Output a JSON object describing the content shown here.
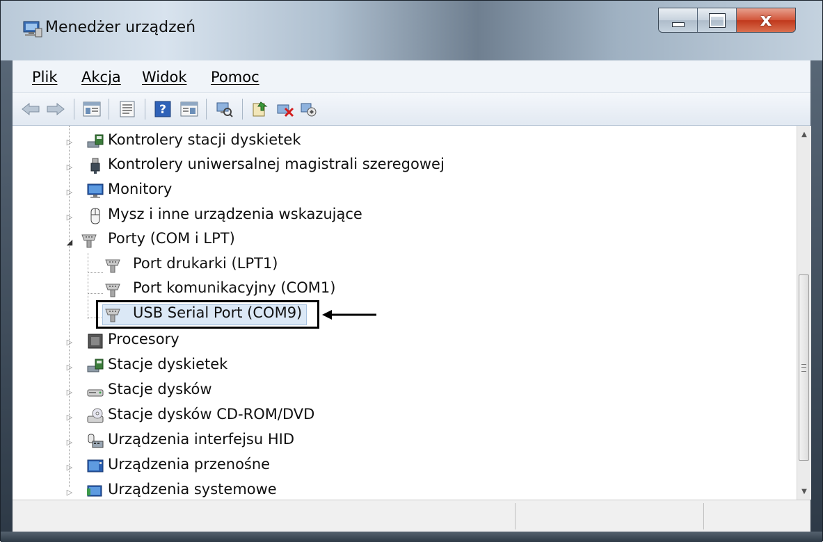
{
  "window": {
    "title": "Menedżer urządzeń",
    "close_glyph": "x"
  },
  "menu": {
    "items": [
      "Plik",
      "Akcja",
      "Widok",
      "Pomoc"
    ]
  },
  "toolbar": {
    "icons": [
      "back-arrow-icon",
      "forward-arrow-icon",
      "properties-icon",
      "view-icon",
      "help-icon",
      "console-icon",
      "scan-hardware-icon",
      "update-driver-icon",
      "uninstall-device-icon",
      "disable-device-icon"
    ]
  },
  "tree": {
    "items": [
      {
        "label": "Kontrolery stacji dyskietek",
        "expanded": false
      },
      {
        "label": "Kontrolery uniwersalnej magistrali szeregowej",
        "expanded": false
      },
      {
        "label": "Monitory",
        "expanded": false
      },
      {
        "label": "Mysz i inne urządzenia wskazujące",
        "expanded": false
      },
      {
        "label": "Porty (COM i LPT)",
        "expanded": true,
        "children": [
          {
            "label": "Port drukarki (LPT1)"
          },
          {
            "label": "Port komunikacyjny (COM1)"
          },
          {
            "label": "USB Serial Port (COM9)",
            "selected": true
          }
        ]
      },
      {
        "label": "Procesory",
        "expanded": false
      },
      {
        "label": "Stacje dyskietek",
        "expanded": false
      },
      {
        "label": "Stacje dysków",
        "expanded": false
      },
      {
        "label": "Stacje dysków CD-ROM/DVD",
        "expanded": false
      },
      {
        "label": "Urządzenia interfejsu HID",
        "expanded": false
      },
      {
        "label": "Urządzenia przenośne",
        "expanded": false
      },
      {
        "label": "Urządzenia systemowe",
        "expanded": false
      }
    ]
  },
  "colors": {
    "selection_bg": "#dbe8f6",
    "highlight_box": "#000000",
    "close_button": "#c8442a"
  }
}
